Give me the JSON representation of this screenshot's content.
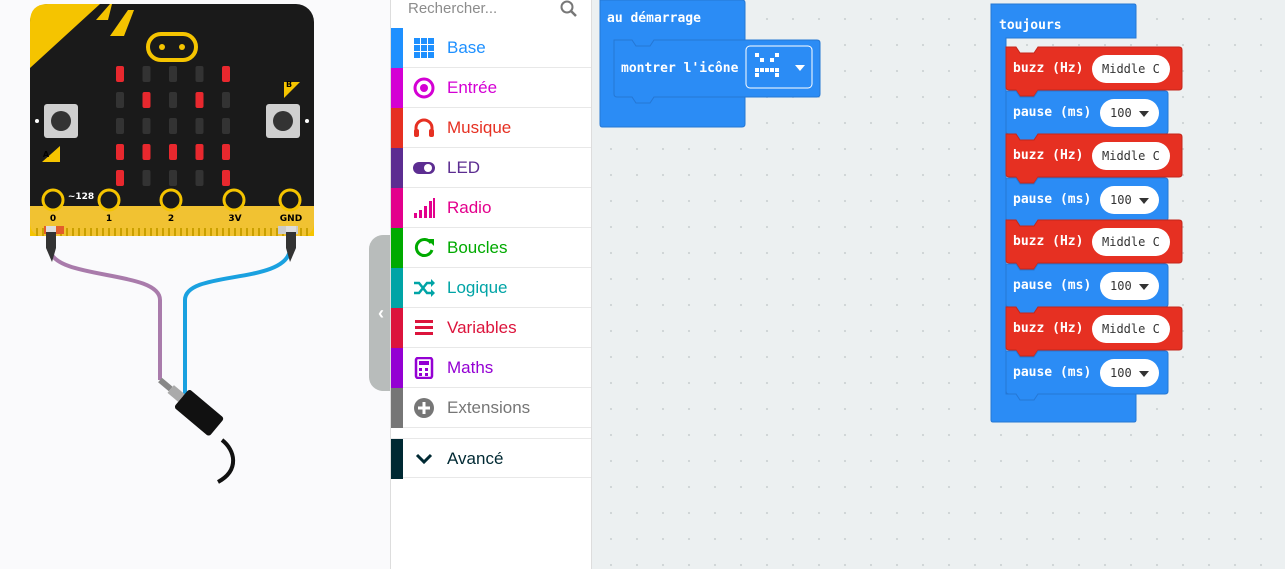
{
  "simulator": {
    "pins": [
      "0",
      "1",
      "2",
      "3V",
      "GND"
    ],
    "pin0_value": "~128",
    "button_a": "A",
    "button_b": "B"
  },
  "toolbox": {
    "search_placeholder": "Rechercher...",
    "categories": [
      {
        "label": "Base",
        "color": "#1e90ff",
        "icon": "grid-icon"
      },
      {
        "label": "Entrée",
        "color": "#d400d4",
        "icon": "target-icon"
      },
      {
        "label": "Musique",
        "color": "#e63022",
        "icon": "headphones-icon"
      },
      {
        "label": "LED",
        "color": "#5c2d91",
        "icon": "toggle-icon"
      },
      {
        "label": "Radio",
        "color": "#e3008c",
        "icon": "signal-icon"
      },
      {
        "label": "Boucles",
        "color": "#00aa00",
        "icon": "refresh-icon"
      },
      {
        "label": "Logique",
        "color": "#00a4a6",
        "icon": "shuffle-icon"
      },
      {
        "label": "Variables",
        "color": "#dc143c",
        "icon": "list-icon"
      },
      {
        "label": "Maths",
        "color": "#9400d3",
        "icon": "calculator-icon"
      },
      {
        "label": "Extensions",
        "color": "#767676",
        "icon": "plus-circle-icon"
      }
    ],
    "advanced": {
      "label": "Avancé",
      "color": "#002933"
    }
  },
  "workspace": {
    "on_start": {
      "label": "au démarrage",
      "show_icon": "montrer l'icône"
    },
    "forever": {
      "label": "toujours",
      "steps": [
        {
          "type": "buzz",
          "label": "buzz (Hz)",
          "value": "Middle C"
        },
        {
          "type": "pause",
          "label": "pause (ms)",
          "value": "100"
        },
        {
          "type": "buzz",
          "label": "buzz (Hz)",
          "value": "Middle C"
        },
        {
          "type": "pause",
          "label": "pause (ms)",
          "value": "100"
        },
        {
          "type": "buzz",
          "label": "buzz (Hz)",
          "value": "Middle C"
        },
        {
          "type": "pause",
          "label": "pause (ms)",
          "value": "100"
        },
        {
          "type": "buzz",
          "label": "buzz (Hz)",
          "value": "Middle C"
        },
        {
          "type": "pause",
          "label": "pause (ms)",
          "value": "100"
        }
      ]
    }
  },
  "colors": {
    "base_blue": "#2b8cf5",
    "music_red": "#e63022",
    "led_red": "#e8282e"
  }
}
